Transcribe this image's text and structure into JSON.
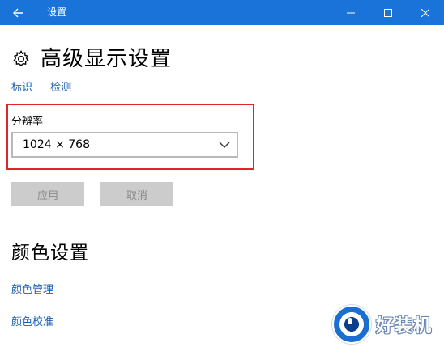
{
  "window": {
    "title": "设置",
    "controls": {
      "back_icon": "arrow-left-icon",
      "minimize_icon": "minimize-icon",
      "maximize_icon": "maximize-icon",
      "close_icon": "close-icon"
    }
  },
  "header": {
    "icon": "gear-icon",
    "title": "高级显示设置",
    "links": [
      "标识",
      "检测"
    ]
  },
  "resolution": {
    "label": "分辨率",
    "selected": "1024 × 768",
    "highlight_color": "#e0262a"
  },
  "actions": {
    "apply_label": "应用",
    "cancel_label": "取消"
  },
  "color_settings": {
    "title": "颜色设置",
    "links": [
      "颜色管理",
      "颜色校准"
    ]
  },
  "watermark": {
    "text": "好装机"
  },
  "theme": {
    "accent": "#1a73d8",
    "link": "#1a5fb4"
  }
}
